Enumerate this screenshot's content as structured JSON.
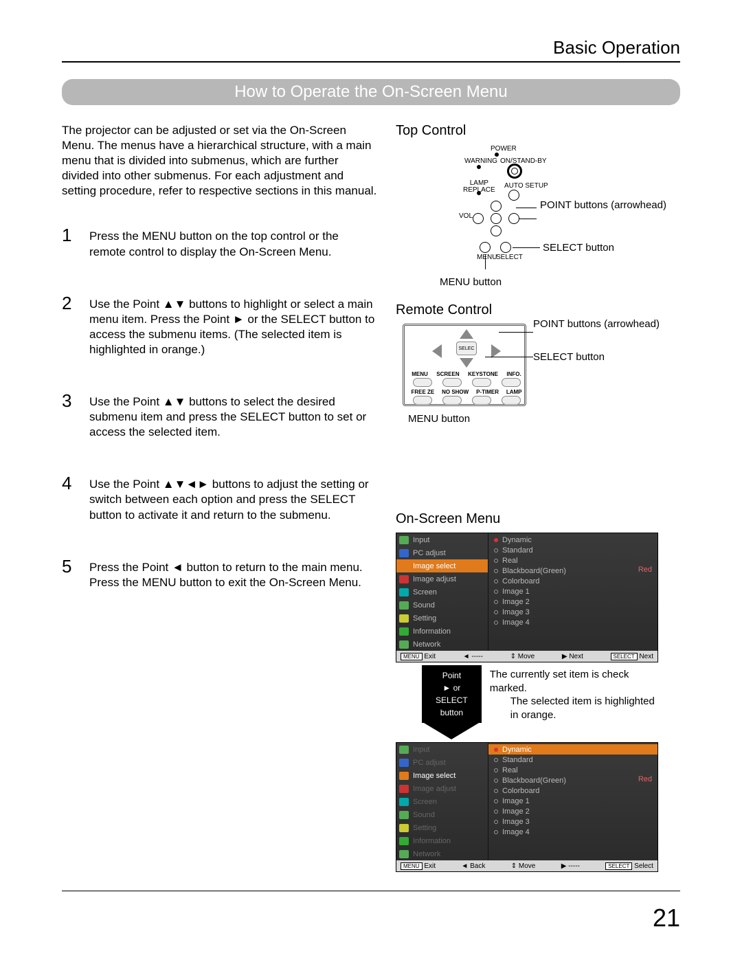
{
  "header": {
    "section": "Basic Operation"
  },
  "banner": "How to Operate the On-Screen Menu",
  "intro": "The projector can be adjusted or set via the On-Screen Menu. The menus have a hierarchical structure, with a main menu that is divided into submenus, which are further divided into other submenus. For each adjustment and setting procedure, refer to respective sections in this manual.",
  "steps": [
    {
      "n": "1",
      "t": "Press the MENU button on the top control or the remote control to display the On-Screen Menu."
    },
    {
      "n": "2",
      "t": "Use the Point ▲▼ buttons to highlight or select a main menu item. Press the Point ► or the SELECT button to access the submenu items. (The selected item is highlighted in orange.)"
    },
    {
      "n": "3",
      "t": "Use the Point ▲▼ buttons to select the desired submenu item and press the SELECT button to set or access the selected item."
    },
    {
      "n": "4",
      "t": "Use the Point ▲▼◄► buttons to adjust the setting or switch between each option and press the SELECT button to activate it and return to the submenu."
    },
    {
      "n": "5",
      "t": "Press the Point ◄ button to return to the main menu. Press the MENU button to exit the On-Screen Menu."
    }
  ],
  "topcontrol": {
    "title": "Top Control",
    "labels": {
      "power": "POWER",
      "warning": "WARNING",
      "standby": "ON/STAND-BY",
      "lamp": "LAMP\nREPLACE",
      "auto": "AUTO SETUP",
      "vol": "VOL",
      "menu_icon": "MENU",
      "select_icon": "SELECT"
    },
    "ann": {
      "point": "POINT buttons (arrowhead)",
      "select": "SELECT button",
      "menu": "MENU button"
    }
  },
  "remote": {
    "title": "Remote Control",
    "select_label": "SELEC",
    "row1": [
      "MENU",
      "SCREEN",
      "KEYSTONE",
      "INFO."
    ],
    "row2": [
      "FREE ZE",
      "NO SHOW",
      "P-TIMER",
      "LAMP"
    ],
    "ann": {
      "point": "POINT buttons (arrowhead)",
      "select": "SELECT button",
      "menu": "MENU button"
    }
  },
  "osm": {
    "title": "On-Screen Menu",
    "menu": [
      "Input",
      "PC adjust",
      "Image select",
      "Image adjust",
      "Screen",
      "Sound",
      "Setting",
      "Information",
      "Network"
    ],
    "sub": [
      "Dynamic",
      "Standard",
      "Real",
      "Blackboard(Green)",
      "Colorboard",
      "Image 1",
      "Image 2",
      "Image 3",
      "Image 4"
    ],
    "tag": "Red",
    "bar1": {
      "exit_box": "MENU",
      "exit": "Exit",
      "back": "◄ -----",
      "move": "⇕ Move",
      "next": "▶ Next",
      "nextbox": "SELECT",
      "next2": "Next"
    },
    "between": {
      "point_hdr": "Point",
      "point_txt": "► or SELECT",
      "point_btn": "button",
      "ann1": "The currently set item is check marked.",
      "ann2": "The selected item is highlighted in orange."
    },
    "bar2": {
      "exit_box": "MENU",
      "exit": "Exit",
      "back": "◄ Back",
      "move": "⇕ Move",
      "next": "▶ -----",
      "nextbox": "SELECT",
      "next2": "Select"
    }
  },
  "pagenum": "21"
}
